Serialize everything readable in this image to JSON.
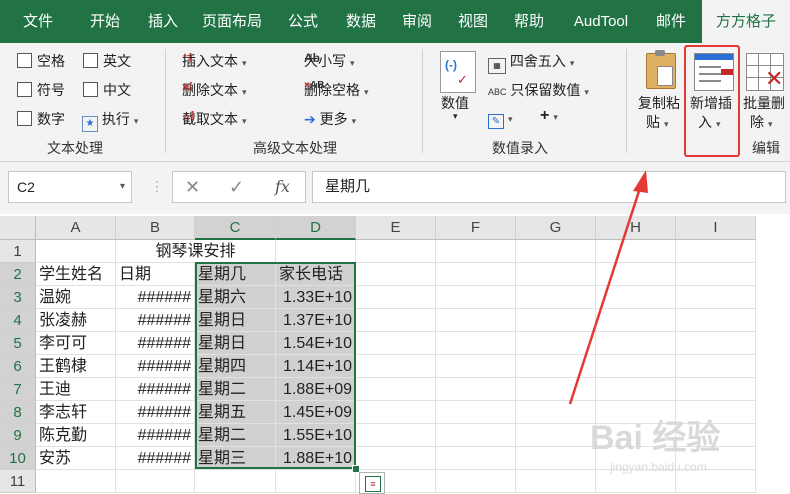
{
  "tabs": [
    "文件",
    "开始",
    "插入",
    "页面布局",
    "公式",
    "数据",
    "审阅",
    "视图",
    "帮助",
    "AudTool",
    "邮件",
    "方方格子"
  ],
  "ribbon": {
    "text_group": {
      "items": [
        "空格",
        "英文",
        "符号",
        "中文",
        "数字",
        "执行"
      ],
      "label": "文本处理"
    },
    "adv_group": {
      "items": [
        "插入文本",
        "删除文本",
        "截取文本",
        "大小写",
        "删除空格",
        "更多"
      ],
      "label": "高级文本处理"
    },
    "num_group": {
      "value_label": "数值",
      "round_label": "四舍五入",
      "keep_label": "只保留数值",
      "plus": "+",
      "label": "数值录入"
    },
    "edit_group": {
      "copy_paste_1": "复制粘",
      "copy_paste_2": "贴",
      "new_insert_1": "新增插",
      "new_insert_2": "入",
      "batch_del_1": "批量删",
      "batch_del_2": "除",
      "label": "编辑"
    }
  },
  "formula_bar": {
    "name_box": "C2",
    "fx": "fx",
    "value": "星期几"
  },
  "sheet": {
    "columns": [
      "A",
      "B",
      "C",
      "D",
      "E",
      "F",
      "G",
      "H",
      "I"
    ],
    "rows": [
      "1",
      "2",
      "3",
      "4",
      "5",
      "6",
      "7",
      "8",
      "9",
      "10",
      "11"
    ],
    "title": "钢琴课安排",
    "headers": [
      "学生姓名",
      "日期",
      "星期几",
      "家长电话"
    ],
    "data": [
      [
        "温婉",
        "######",
        "星期六",
        "1.33E+10"
      ],
      [
        "张凌赫",
        "######",
        "星期日",
        "1.37E+10"
      ],
      [
        "李可可",
        "######",
        "星期日",
        "1.54E+10"
      ],
      [
        "王鹤棣",
        "######",
        "星期四",
        "1.14E+10"
      ],
      [
        "王迪",
        "######",
        "星期二",
        "1.88E+09"
      ],
      [
        "李志轩",
        "######",
        "星期五",
        "1.45E+09"
      ],
      [
        "陈克勤",
        "######",
        "星期二",
        "1.55E+10"
      ],
      [
        "安苏",
        "######",
        "星期三",
        "1.88E+10"
      ]
    ]
  },
  "watermark": {
    "main": "Bai 经验",
    "sub": "jingyan.baidu.com"
  },
  "colors": {
    "accent": "#217346",
    "highlight": "#e53935"
  }
}
